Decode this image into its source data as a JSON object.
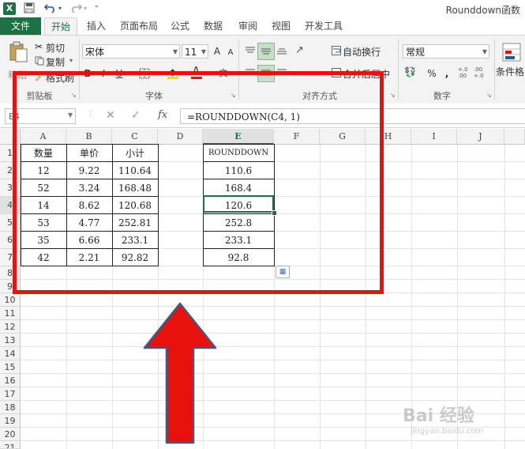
{
  "titlebar": {
    "app_icon": "X",
    "window_title": "Rounddown函数"
  },
  "tabs": [
    "文件",
    "开始",
    "插入",
    "页面布局",
    "公式",
    "数据",
    "审阅",
    "视图",
    "开发工具"
  ],
  "ribbon": {
    "clipboard": {
      "paste": "粘贴",
      "cut": "剪切",
      "copy": "复制",
      "format_painter": "格式刷",
      "group_label": "剪贴板"
    },
    "font": {
      "name": "宋体",
      "size": "11",
      "grow": "A",
      "shrink": "A",
      "bold": "B",
      "italic": "I",
      "underline": "U",
      "phonetic": "文",
      "group_label": "字体"
    },
    "alignment": {
      "wrap_text": "自动换行",
      "merge_center": "合并后居中",
      "group_label": "对齐方式"
    },
    "number": {
      "format": "常规",
      "percent": "%",
      "comma": ",",
      "inc_decimal": "+.0 .00",
      "dec_decimal": ".00 +.0",
      "group_label": "数字"
    },
    "styles": {
      "conditional": "条件格"
    }
  },
  "formula_bar": {
    "name_box": "E4",
    "cancel": "✕",
    "enter": "✓",
    "fx": "fx",
    "formula": "=ROUNDDOWN(C4, 1)"
  },
  "sheet": {
    "columns": [
      "A",
      "B",
      "C",
      "D",
      "E",
      "F",
      "G",
      "H",
      "I",
      "J"
    ],
    "rows": [
      "1",
      "2",
      "3",
      "4",
      "5",
      "6",
      "7",
      "8",
      "9",
      "10",
      "11",
      "12",
      "13",
      "14",
      "15",
      "16",
      "17",
      "18",
      "19",
      "20",
      "21"
    ],
    "header": {
      "a": "数量",
      "b": "单价",
      "c": "小计",
      "e": "ROUNDDOWN"
    },
    "data": [
      {
        "a": "12",
        "b": "9.22",
        "c": "110.64",
        "e": "110.6"
      },
      {
        "a": "52",
        "b": "3.24",
        "c": "168.48",
        "e": "168.4"
      },
      {
        "a": "14",
        "b": "8.62",
        "c": "120.68",
        "e": "120.6"
      },
      {
        "a": "53",
        "b": "4.77",
        "c": "252.81",
        "e": "252.8"
      },
      {
        "a": "35",
        "b": "6.66",
        "c": "233.1",
        "e": "233.1"
      },
      {
        "a": "42",
        "b": "2.21",
        "c": "92.82",
        "e": "92.8"
      }
    ]
  },
  "annotation": {
    "highlight_color": "#e8120c",
    "arrow_color": "#e8120c"
  },
  "watermark": {
    "main": "Bai 经验",
    "sub": "jingyan.baidu.com"
  }
}
